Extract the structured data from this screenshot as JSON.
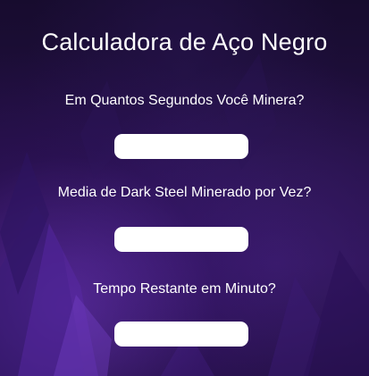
{
  "calculator": {
    "title": "Calculadora de Aço Negro",
    "fields": [
      {
        "label": "Em Quantos Segundos Você Minera?",
        "value": "",
        "placeholder": ""
      },
      {
        "label": "Media de Dark Steel Minerado por Vez?",
        "value": "",
        "placeholder": ""
      },
      {
        "label": "Tempo Restante em Minuto?",
        "value": "",
        "placeholder": ""
      }
    ]
  },
  "theme": {
    "background": "#1a0d33",
    "accent": "#6a3cc8",
    "text": "#ffffff",
    "input_background": "#ffffff"
  }
}
